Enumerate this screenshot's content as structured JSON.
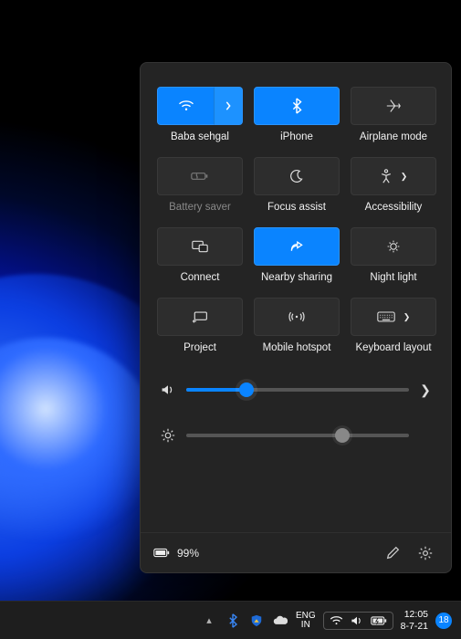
{
  "accent_color": "#0a84ff",
  "panel": {
    "tiles": [
      {
        "id": "wifi",
        "label": "Baba sehgal",
        "icon": "wifi-icon",
        "active": true,
        "split": true,
        "disabled": false
      },
      {
        "id": "bluetooth",
        "label": "iPhone",
        "icon": "bluetooth-icon",
        "active": true,
        "split": false,
        "disabled": false
      },
      {
        "id": "airplane",
        "label": "Airplane mode",
        "icon": "airplane-icon",
        "active": false,
        "split": false,
        "disabled": false
      },
      {
        "id": "battery",
        "label": "Battery saver",
        "icon": "battery-saver-icon",
        "active": false,
        "split": false,
        "disabled": true
      },
      {
        "id": "focus",
        "label": "Focus assist",
        "icon": "moon-icon",
        "active": false,
        "split": false,
        "disabled": false
      },
      {
        "id": "access",
        "label": "Accessibility",
        "icon": "accessibility-icon",
        "active": false,
        "split": false,
        "disabled": false,
        "chevron": true
      },
      {
        "id": "connect",
        "label": "Connect",
        "icon": "connect-icon",
        "active": false,
        "split": false,
        "disabled": false
      },
      {
        "id": "nearby",
        "label": "Nearby sharing",
        "icon": "share-icon",
        "active": true,
        "split": false,
        "disabled": false
      },
      {
        "id": "night",
        "label": "Night light",
        "icon": "nightlight-icon",
        "active": false,
        "split": false,
        "disabled": false
      },
      {
        "id": "project",
        "label": "Project",
        "icon": "project-icon",
        "active": false,
        "split": false,
        "disabled": false
      },
      {
        "id": "hotspot",
        "label": "Mobile hotspot",
        "icon": "hotspot-icon",
        "active": false,
        "split": false,
        "disabled": false
      },
      {
        "id": "keyboard",
        "label": "Keyboard layout",
        "icon": "keyboard-icon",
        "active": false,
        "split": false,
        "disabled": false,
        "chevron": true
      }
    ],
    "volume_percent": 27,
    "brightness_percent": 70,
    "battery_text": "99%"
  },
  "taskbar": {
    "lang_top": "ENG",
    "lang_bottom": "IN",
    "time": "12:05",
    "date": "8-7-21",
    "notification_count": "18"
  }
}
